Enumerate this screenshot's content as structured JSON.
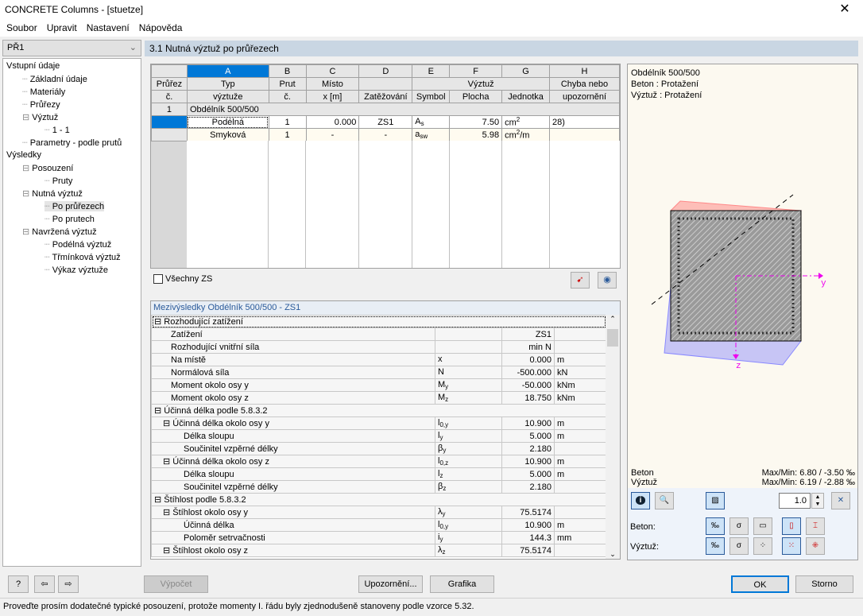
{
  "window": {
    "title": "CONCRETE Columns - [stuetze]",
    "close": "✕"
  },
  "menu": [
    "Soubor",
    "Upravit",
    "Nastavení",
    "Nápověda"
  ],
  "left": {
    "case": "PŘ1",
    "tree": [
      {
        "label": "Vstupní údaje",
        "level": 0
      },
      {
        "label": "Základní údaje",
        "level": 1
      },
      {
        "label": "Materiály",
        "level": 1
      },
      {
        "label": "Průřezy",
        "level": 1
      },
      {
        "label": "Výztuž",
        "level": 1,
        "expand": true
      },
      {
        "label": "1 - 1",
        "level": 2
      },
      {
        "label": "Parametry - podle prutů",
        "level": 1
      },
      {
        "label": "Výsledky",
        "level": 0
      },
      {
        "label": "Posouzení",
        "level": 1,
        "expand": true
      },
      {
        "label": "Pruty",
        "level": 2
      },
      {
        "label": "Nutná výztuž",
        "level": 1,
        "expand": true
      },
      {
        "label": "Po průřezech",
        "level": 2,
        "selected": true
      },
      {
        "label": "Po prutech",
        "level": 2
      },
      {
        "label": "Navržená výztuž",
        "level": 1,
        "expand": true
      },
      {
        "label": "Podélná výztuž",
        "level": 2
      },
      {
        "label": "Třmínková výztuž",
        "level": 2
      },
      {
        "label": "Výkaz výztuže",
        "level": 2
      }
    ]
  },
  "main": {
    "title": "3.1 Nutná výztuž po průřezech"
  },
  "upper": {
    "col_letters": [
      "A",
      "B",
      "C",
      "D",
      "E",
      "F",
      "G",
      "H"
    ],
    "h1": [
      "Průřez",
      "Typ",
      "Prut",
      "Místo",
      "",
      "Výztuž",
      "Chyba nebo"
    ],
    "h2": [
      "č.",
      "výztuže",
      "č.",
      "x [m]",
      "Zatěžování",
      "Symbol",
      "Plocha",
      "Jednotka",
      "upozornění"
    ],
    "group": {
      "no": "1",
      "label": "Obdélník 500/500"
    },
    "rows": [
      {
        "typ": "Podélná",
        "prut": "1",
        "x": "0.000",
        "zat": "ZS1",
        "sym": "A",
        "symsub": "s",
        "plocha": "7.50",
        "jed": "cm",
        "jedsup": "2",
        "jedtail": "",
        "chyba": "28)"
      },
      {
        "typ": "Smyková",
        "prut": "1",
        "x": "-",
        "zat": "-",
        "sym": "a",
        "symsub": "sw",
        "plocha": "5.98",
        "jed": "cm",
        "jedsup": "2",
        "jedtail": "/m",
        "chyba": ""
      }
    ],
    "all_cases": "Všechny ZS"
  },
  "mid": {
    "title": "Mezivýsledky Obdélník 500/500 - ZS1",
    "rows": [
      {
        "l": 0,
        "t": "Rozhodující zatížení",
        "s": "",
        "ss": "",
        "v": "",
        "u": "",
        "sect": true
      },
      {
        "l": 1,
        "t": "Zatížení",
        "s": "",
        "ss": "",
        "v": "ZS1",
        "u": ""
      },
      {
        "l": 1,
        "t": "Rozhodující vnitřní síla",
        "s": "",
        "ss": "",
        "v": "min N",
        "u": ""
      },
      {
        "l": 1,
        "t": "Na místě",
        "s": "x",
        "ss": "",
        "v": "0.000",
        "u": "m"
      },
      {
        "l": 1,
        "t": "Normálová síla",
        "s": "N",
        "ss": "",
        "v": "-500.000",
        "u": "kN"
      },
      {
        "l": 1,
        "t": "Moment okolo osy y",
        "s": "M",
        "ss": "y",
        "v": "-50.000",
        "u": "kNm"
      },
      {
        "l": 1,
        "t": "Moment okolo osy z",
        "s": "M",
        "ss": "z",
        "v": "18.750",
        "u": "kNm"
      },
      {
        "l": 0,
        "t": "Účinná délka podle 5.8.3.2",
        "s": "",
        "ss": "",
        "v": "",
        "u": "",
        "sect": true
      },
      {
        "l": 1,
        "t": "Účinná délka okolo osy y",
        "s": "l",
        "ss": "0,y",
        "v": "10.900",
        "u": "m",
        "exp": true
      },
      {
        "l": 2,
        "t": "Délka sloupu",
        "s": "l",
        "ss": "y",
        "v": "5.000",
        "u": "m"
      },
      {
        "l": 2,
        "t": "Součinitel vzpěrné délky",
        "s": "β",
        "ss": "y",
        "v": "2.180",
        "u": ""
      },
      {
        "l": 1,
        "t": "Účinná délka okolo osy z",
        "s": "l",
        "ss": "0,z",
        "v": "10.900",
        "u": "m",
        "exp": true
      },
      {
        "l": 2,
        "t": "Délka sloupu",
        "s": "l",
        "ss": "z",
        "v": "5.000",
        "u": "m"
      },
      {
        "l": 2,
        "t": "Součinitel vzpěrné délky",
        "s": "β",
        "ss": "z",
        "v": "2.180",
        "u": ""
      },
      {
        "l": 0,
        "t": "Štíhlost podle 5.8.3.2",
        "s": "",
        "ss": "",
        "v": "",
        "u": "",
        "sect": true
      },
      {
        "l": 1,
        "t": "Štíhlost okolo osy y",
        "s": "λ",
        "ss": "y",
        "v": "75.5174",
        "u": "",
        "exp": true
      },
      {
        "l": 2,
        "t": "Účinná délka",
        "s": "l",
        "ss": "0,y",
        "v": "10.900",
        "u": "m"
      },
      {
        "l": 2,
        "t": "Poloměr setrvačnosti",
        "s": "i",
        "ss": "y",
        "v": "144.3",
        "u": "mm"
      },
      {
        "l": 1,
        "t": "Štíhlost okolo osy z",
        "s": "λ",
        "ss": "z",
        "v": "75.5174",
        "u": "",
        "exp": true
      }
    ]
  },
  "graphic": {
    "info": [
      "Obdélník 500/500",
      "Beton : Protažení",
      "Výztuž : Protažení"
    ],
    "axis_y": "y",
    "axis_z": "z",
    "beton_label": "Beton",
    "beton_maxmin": "Max/Min: 6.80 / -3.50 ‰",
    "vyztuz_label": "Výztuž",
    "vyztuz_maxmin": "Max/Min: 6.19 / -2.88 ‰",
    "scale": "1.0",
    "beton": "Beton:",
    "vyztuz": "Výztuž:"
  },
  "buttons": {
    "calc": "Výpočet",
    "warn": "Upozornění...",
    "graphic": "Grafika",
    "ok": "OK",
    "cancel": "Storno"
  },
  "status": "Proveďte prosím dodatečné typické posouzení, protože momenty I. řádu byly zjednodušeně stanoveny podle vzorce 5.32."
}
